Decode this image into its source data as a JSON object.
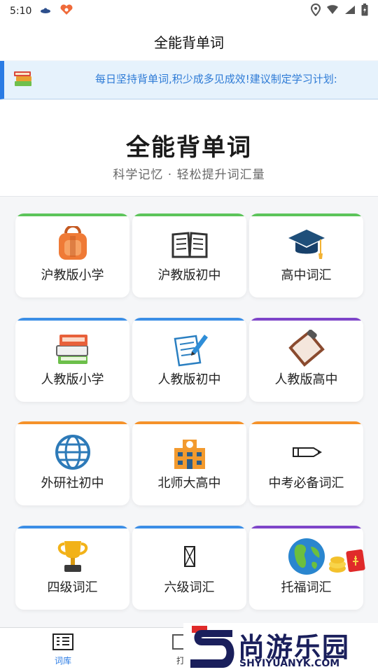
{
  "status_bar": {
    "time": "5:10"
  },
  "header": {
    "title": "全能背单词"
  },
  "notice": {
    "text": "每日坚持背单词,积少成多见成效!建议制定学习计划:"
  },
  "hero": {
    "title": "全能背单词",
    "subtitle": "科学记忆 · 轻松提升词汇量"
  },
  "books": [
    {
      "label": "沪教版小学",
      "icon": "backpack-icon",
      "accent": "#5cc45a"
    },
    {
      "label": "沪教版初中",
      "icon": "open-book-icon",
      "accent": "#5cc45a"
    },
    {
      "label": "高中词汇",
      "icon": "graduation-cap-icon",
      "accent": "#5cc45a"
    },
    {
      "label": "人教版小学",
      "icon": "book-stack-icon",
      "accent": "#3b8ee6"
    },
    {
      "label": "人教版初中",
      "icon": "memo-pencil-icon",
      "accent": "#3b8ee6"
    },
    {
      "label": "人教版高中",
      "icon": "clipboard-icon",
      "accent": "#7e45c9"
    },
    {
      "label": "外研社初中",
      "icon": "globe-icon",
      "accent": "#f5922a"
    },
    {
      "label": "北师大高中",
      "icon": "school-icon",
      "accent": "#f5922a"
    },
    {
      "label": "中考必备词汇",
      "icon": "pencil-icon",
      "accent": "#f5922a"
    },
    {
      "label": "四级词汇",
      "icon": "trophy-icon",
      "accent": "#3b8ee6"
    },
    {
      "label": "六级词汇",
      "icon": "placeholder-icon",
      "accent": "#3b8ee6"
    },
    {
      "label": "托福词汇",
      "icon": "earth-icon",
      "accent": "#7e45c9"
    }
  ],
  "nav": {
    "tab1_label": "词库",
    "tab2_label": "打"
  },
  "watermark": {
    "brand": "尚游乐园",
    "url": "SHYIYUANYK.COM",
    "color": "#1a1f5c"
  },
  "colors": {
    "primary": "#2a7be4",
    "notice_bg": "#e6f2fc",
    "notice_text": "#2e7bd6"
  }
}
